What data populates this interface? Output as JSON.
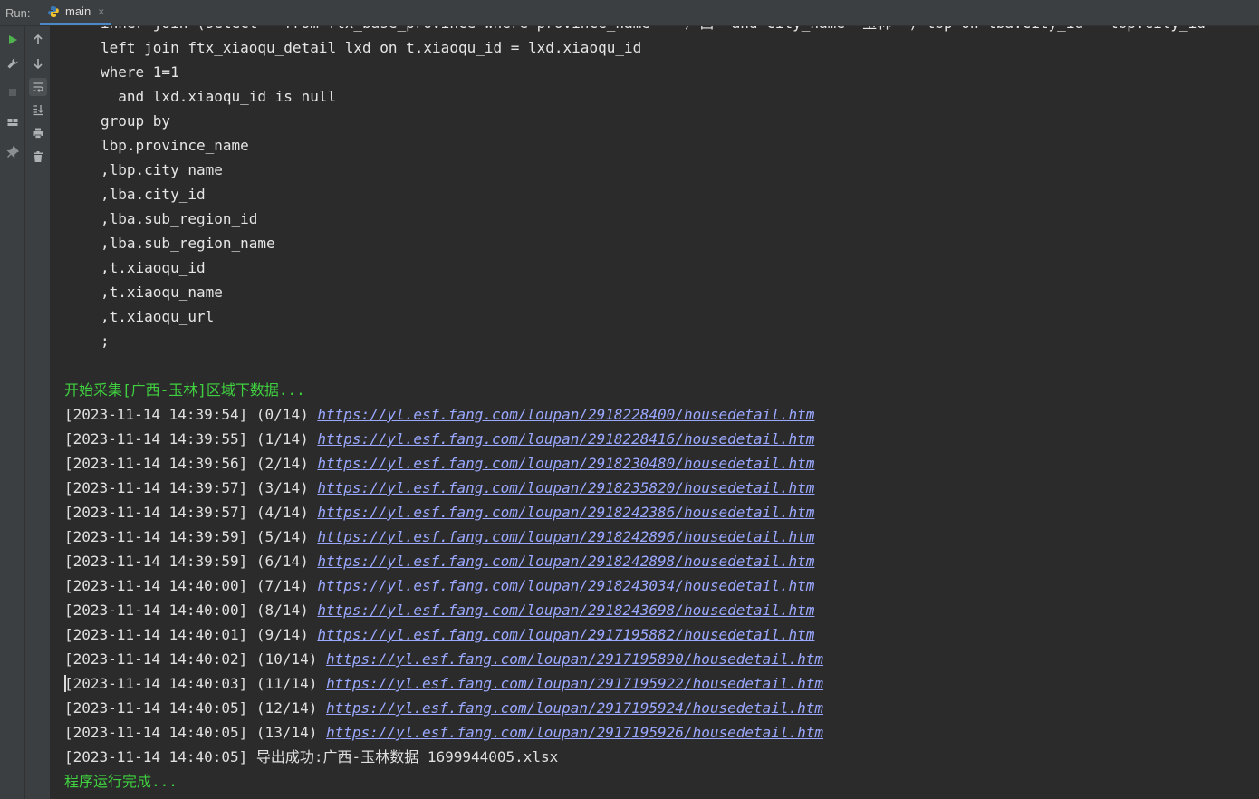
{
  "toolbar": {
    "run_label": "Run:",
    "tab_label": "main",
    "tab_close": "×"
  },
  "icons": {
    "left1": [
      "play-icon",
      "wrench-icon",
      "stop-icon",
      "layout-icon",
      "pin-icon"
    ],
    "left2": [
      "arrow-up-icon",
      "arrow-down-icon",
      "soft-wrap-icon",
      "scroll-to-end-icon",
      "print-icon",
      "trash-icon"
    ]
  },
  "colors": {
    "green_text": "#3fd13f",
    "link": "#9aa8ff",
    "background": "#2b2b2b"
  },
  "console": {
    "sql_lines": [
      "inner join (select * from ftx_base_province where province_name = '广西' and city_name='玉林' ) lbp on lba.city_id = lbp.city_id",
      "left join ftx_xiaoqu_detail lxd on t.xiaoqu_id = lxd.xiaoqu_id",
      "where 1=1",
      "  and lxd.xiaoqu_id is null",
      "group by",
      "lbp.province_name",
      ",lbp.city_name",
      ",lba.city_id",
      ",lba.sub_region_id",
      ",lba.sub_region_name",
      ",t.xiaoqu_id",
      ",t.xiaoqu_name",
      ",t.xiaoqu_url",
      ";"
    ],
    "start_message": "开始采集[广西-玉林]区域下数据...",
    "log_rows": [
      {
        "prefix": "[2023-11-14 14:39:54] (0/14) ",
        "url": "https://yl.esf.fang.com/loupan/2918228400/housedetail.htm"
      },
      {
        "prefix": "[2023-11-14 14:39:55] (1/14) ",
        "url": "https://yl.esf.fang.com/loupan/2918228416/housedetail.htm"
      },
      {
        "prefix": "[2023-11-14 14:39:56] (2/14) ",
        "url": "https://yl.esf.fang.com/loupan/2918230480/housedetail.htm"
      },
      {
        "prefix": "[2023-11-14 14:39:57] (3/14) ",
        "url": "https://yl.esf.fang.com/loupan/2918235820/housedetail.htm"
      },
      {
        "prefix": "[2023-11-14 14:39:57] (4/14) ",
        "url": "https://yl.esf.fang.com/loupan/2918242386/housedetail.htm"
      },
      {
        "prefix": "[2023-11-14 14:39:59] (5/14) ",
        "url": "https://yl.esf.fang.com/loupan/2918242896/housedetail.htm"
      },
      {
        "prefix": "[2023-11-14 14:39:59] (6/14) ",
        "url": "https://yl.esf.fang.com/loupan/2918242898/housedetail.htm"
      },
      {
        "prefix": "[2023-11-14 14:40:00] (7/14) ",
        "url": "https://yl.esf.fang.com/loupan/2918243034/housedetail.htm"
      },
      {
        "prefix": "[2023-11-14 14:40:00] (8/14) ",
        "url": "https://yl.esf.fang.com/loupan/2918243698/housedetail.htm"
      },
      {
        "prefix": "[2023-11-14 14:40:01] (9/14) ",
        "url": "https://yl.esf.fang.com/loupan/2917195882/housedetail.htm"
      },
      {
        "prefix": "[2023-11-14 14:40:02] (10/14) ",
        "url": "https://yl.esf.fang.com/loupan/2917195890/housedetail.htm"
      },
      {
        "prefix": "[2023-11-14 14:40:03] (11/14) ",
        "url": "https://yl.esf.fang.com/loupan/2917195922/housedetail.htm"
      },
      {
        "prefix": "[2023-11-14 14:40:05] (12/14) ",
        "url": "https://yl.esf.fang.com/loupan/2917195924/housedetail.htm"
      },
      {
        "prefix": "[2023-11-14 14:40:05] (13/14) ",
        "url": "https://yl.esf.fang.com/loupan/2917195926/housedetail.htm"
      }
    ],
    "export_message": "[2023-11-14 14:40:05] 导出成功:广西-玉林数据_1699944005.xlsx",
    "done_message": "程序运行完成..."
  }
}
